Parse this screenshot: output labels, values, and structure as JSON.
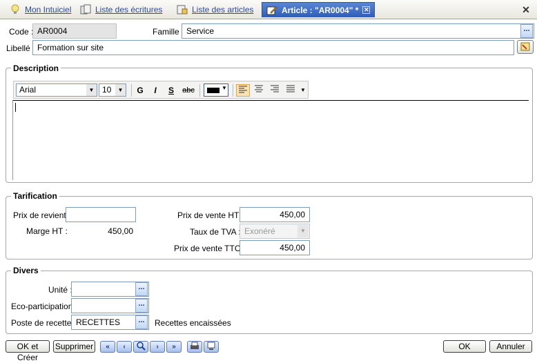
{
  "tabs": [
    {
      "label": "Mon Intuiciel",
      "icon": "lightbulb-icon"
    },
    {
      "label": "Liste des écritures",
      "icon": "documents-icon"
    },
    {
      "label": "Liste des articles",
      "icon": "article-list-icon"
    },
    {
      "label": "Article : \"AR0004\" *",
      "icon": "article-edit-icon"
    }
  ],
  "header": {
    "code_label": "Code :",
    "code_value": "AR0004",
    "famille_label": "Famille :",
    "famille_value": "Service",
    "libelle_label": "Libellé :",
    "libelle_value": "Formation sur site",
    "dots": "..."
  },
  "description": {
    "title": "Description",
    "font": "Arial",
    "size": "10",
    "bold": "G",
    "italic": "I",
    "underline": "S",
    "strike": "abc",
    "text": ""
  },
  "tarification": {
    "title": "Tarification",
    "prix_revient_label": "Prix de revient :",
    "prix_revient_value": "",
    "marge_label": "Marge HT :",
    "marge_value": "450,00",
    "prix_ht_label": "Prix de vente HT :",
    "prix_ht_value": "450,00",
    "tva_label": "Taux de TVA :",
    "tva_value": "Exonéré",
    "prix_ttc_label": "Prix de vente TTC :",
    "prix_ttc_value": "450,00"
  },
  "divers": {
    "title": "Divers",
    "unite_label": "Unité :",
    "unite_value": "",
    "eco_label": "Eco-participation :",
    "eco_value": "",
    "poste_label": "Poste de recette :",
    "poste_value": "RECETTES",
    "poste_desc": "Recettes encaissées"
  },
  "footer": {
    "ok_creer": "OK et Créer",
    "supprimer": "Supprimer",
    "ok": "OK",
    "annuler": "Annuler"
  },
  "colors": {
    "active_tab": "#2e5db8",
    "dots_button": "#c5d7f4",
    "group_border": "#a7a6aa"
  }
}
